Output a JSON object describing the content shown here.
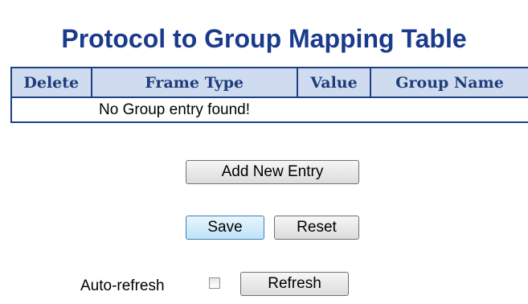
{
  "page": {
    "title": "Protocol to Group Mapping Table"
  },
  "table": {
    "headers": {
      "delete": "Delete",
      "frame_type": "Frame Type",
      "value": "Value",
      "group_name": "Group Name"
    },
    "empty_message": "No Group entry found!"
  },
  "buttons": {
    "add_new_entry": "Add New Entry",
    "save": "Save",
    "reset": "Reset",
    "refresh": "Refresh"
  },
  "auto_refresh": {
    "label": "Auto-refresh",
    "checked": false
  }
}
